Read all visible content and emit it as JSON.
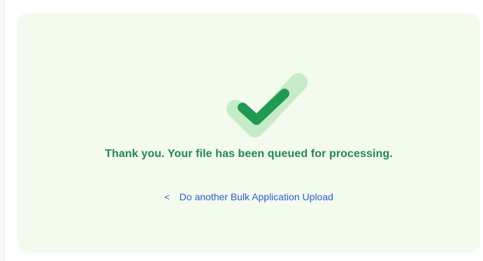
{
  "panel": {
    "message": "Thank you. Your file has been queued for processing.",
    "back_link_label": "Do another Bulk Application Upload",
    "status_icon": "checkmark-icon",
    "back_icon": "chevron-left-icon"
  },
  "colors": {
    "card_background": "#f3faee",
    "success_text": "#1f8a4c",
    "check_dark": "#1e9a52",
    "check_light": "#c6ebc8",
    "link": "#2b5fd8"
  }
}
